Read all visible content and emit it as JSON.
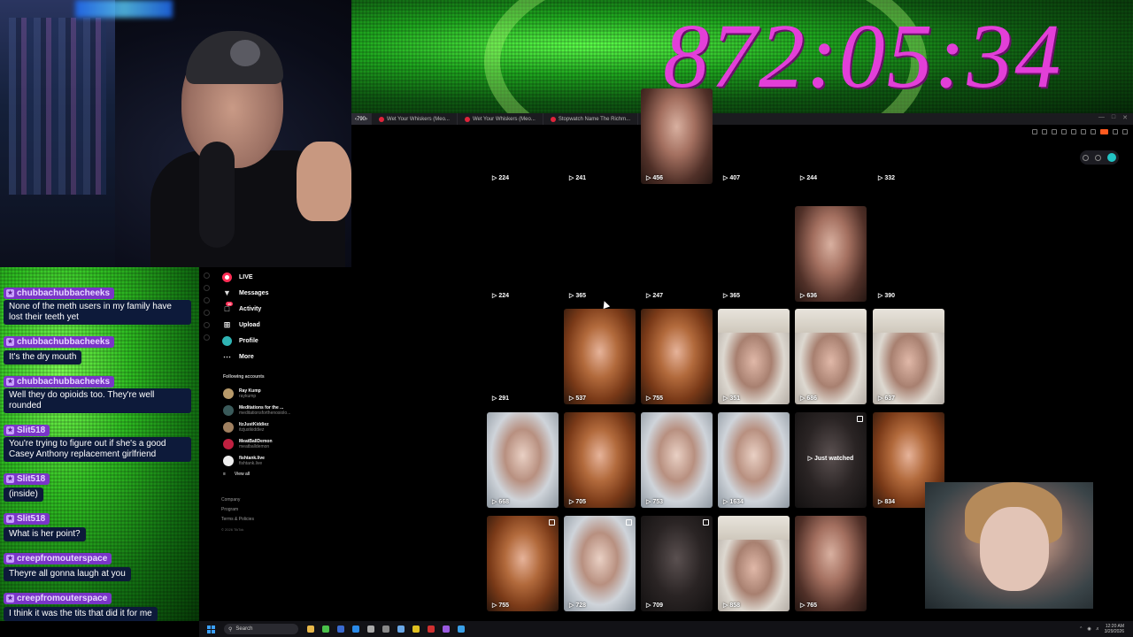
{
  "timer": "872:05:34",
  "browser": {
    "tabs": [
      {
        "label": "‹790›"
      },
      {
        "label": "Wet Your Whiskers (Meo..."
      },
      {
        "label": "Wet Your Whiskers (Meo..."
      },
      {
        "label": "Stopwatch Name The Richm..."
      }
    ],
    "new_tab": "+"
  },
  "tiktok": {
    "nav": [
      {
        "label": "LIVE",
        "icon": "live-icon"
      },
      {
        "label": "Messages",
        "icon": "send-icon"
      },
      {
        "label": "Activity",
        "icon": "activity-icon",
        "badge": "10"
      },
      {
        "label": "Upload",
        "icon": "upload-icon"
      },
      {
        "label": "Profile",
        "icon": "profile-icon"
      },
      {
        "label": "More",
        "icon": "more-icon"
      }
    ],
    "following_title": "Following accounts",
    "accounts": [
      {
        "name": "Ray Kump",
        "handle": "raykump"
      },
      {
        "name": "Meditations for the ...",
        "handle": "meditationsforthenosiolo..."
      },
      {
        "name": "ItzJustKiddiez",
        "handle": "itzjustkiddiez"
      },
      {
        "name": "MeatBallDemon",
        "handle": "meatballdemon"
      },
      {
        "name": "fishtank.live",
        "handle": "fishtank.live"
      }
    ],
    "view_all": "View all",
    "footer": [
      "Company",
      "Program",
      "Terms & Policies",
      "© 2026 TikTok"
    ]
  },
  "grid": [
    {
      "views": "224",
      "thumb": "empty"
    },
    {
      "views": "241",
      "thumb": "empty"
    },
    {
      "views": "456",
      "thumb": "img"
    },
    {
      "views": "407",
      "thumb": "empty"
    },
    {
      "views": "244",
      "thumb": "empty"
    },
    {
      "views": "332",
      "thumb": "empty"
    },
    {
      "views": "224",
      "thumb": "empty"
    },
    {
      "views": "365",
      "thumb": "empty"
    },
    {
      "views": "247",
      "thumb": "empty"
    },
    {
      "views": "365",
      "thumb": "empty"
    },
    {
      "views": "636",
      "thumb": "img"
    },
    {
      "views": "390",
      "thumb": "empty"
    },
    {
      "views": "291",
      "thumb": "empty"
    },
    {
      "views": "537",
      "thumb": "curly"
    },
    {
      "views": "755",
      "thumb": "curly"
    },
    {
      "views": "351",
      "thumb": "beanie"
    },
    {
      "views": "686",
      "thumb": "beanie"
    },
    {
      "views": "637",
      "thumb": "beanie"
    },
    {
      "views": "668",
      "thumb": "light"
    },
    {
      "views": "705",
      "thumb": "curly"
    },
    {
      "views": "753",
      "thumb": "light"
    },
    {
      "views": "1634",
      "thumb": "light"
    },
    {
      "views": "",
      "thumb": "dark",
      "watched": "Just watched",
      "pinned": true
    },
    {
      "views": "834",
      "thumb": "curly"
    },
    {
      "views": "755",
      "thumb": "curly",
      "pinned": true
    },
    {
      "views": "728",
      "thumb": "light",
      "pinned": true
    },
    {
      "views": "709",
      "thumb": "dark",
      "pinned": true
    },
    {
      "views": "858",
      "thumb": "beanie"
    },
    {
      "views": "765",
      "thumb": "img"
    }
  ],
  "chat": [
    {
      "user": "chubbachubbacheeks",
      "text": "None of the meth users in my family have lost their teeth yet"
    },
    {
      "user": "chubbachubbacheeks",
      "text": "It's the dry mouth"
    },
    {
      "user": "chubbachubbacheeks",
      "text": "Well they do opioids too. They're well rounded"
    },
    {
      "user": "Slit518",
      "text": "You're trying to figure out if she's a good Casey Anthony replacement girlfriend"
    },
    {
      "user": "Slit518",
      "text": "(inside)"
    },
    {
      "user": "Slit518",
      "text": "What is her point?"
    },
    {
      "user": "creepfromouterspace",
      "text": "Theyre all gonna laugh at you"
    },
    {
      "user": "creepfromouterspace",
      "text": "I think it was the tits that did it for me"
    }
  ],
  "taskbar": {
    "search": "Search",
    "time": "12:20 AM",
    "date": "3/29/2026"
  },
  "colors": {
    "timer": "#e23fd8",
    "chat_name_bg": "#7a35c8",
    "chat_text_bg": "#0d1a3a",
    "tiktok_accent": "#ff2d55"
  }
}
